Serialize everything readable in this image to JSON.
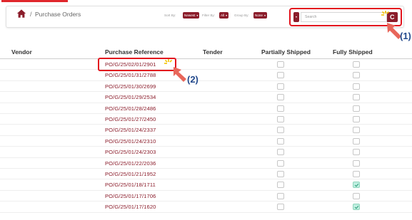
{
  "breadcrumb": {
    "separator": "/",
    "page": "Purchase Orders"
  },
  "controls": {
    "sort_label": "Sort By:",
    "sort_value": "Newest",
    "filter_label": "Filter By:",
    "filter_value": "All",
    "group_label": "Group By:",
    "group_value": "None"
  },
  "search": {
    "placeholder": "Search",
    "button_label": "C"
  },
  "annotations": {
    "step1": "(1)",
    "step2": "(2)"
  },
  "table": {
    "headers": {
      "vendor": "Vendor",
      "reference": "Purchase Reference",
      "tender": "Tender",
      "partial": "Partially Shipped",
      "full": "Fully Shipped"
    },
    "rows": [
      {
        "ref": "PO/G/25/02/01/2901",
        "partial": false,
        "full": false
      },
      {
        "ref": "PO/G/25/01/31/2788",
        "partial": false,
        "full": false
      },
      {
        "ref": "PO/G/25/01/30/2699",
        "partial": false,
        "full": false
      },
      {
        "ref": "PO/G/25/01/29/2534",
        "partial": false,
        "full": false
      },
      {
        "ref": "PO/G/25/01/28/2486",
        "partial": false,
        "full": false
      },
      {
        "ref": "PO/G/25/01/27/2450",
        "partial": false,
        "full": false
      },
      {
        "ref": "PO/G/25/01/24/2337",
        "partial": false,
        "full": false
      },
      {
        "ref": "PO/G/25/01/24/2310",
        "partial": false,
        "full": false
      },
      {
        "ref": "PO/G/25/01/24/2303",
        "partial": false,
        "full": false
      },
      {
        "ref": "PO/G/25/01/22/2036",
        "partial": false,
        "full": false
      },
      {
        "ref": "PO/G/25/01/21/1952",
        "partial": false,
        "full": false
      },
      {
        "ref": "PO/G/25/01/18/1711",
        "partial": false,
        "full": true
      },
      {
        "ref": "PO/G/25/01/17/1706",
        "partial": false,
        "full": false
      },
      {
        "ref": "PO/G/25/01/17/1620",
        "partial": false,
        "full": true
      }
    ]
  },
  "colors": {
    "accent": "#8b1d2b",
    "highlight": "#e3141e",
    "arrow": "#e8665a",
    "step_label": "#234a8d"
  }
}
